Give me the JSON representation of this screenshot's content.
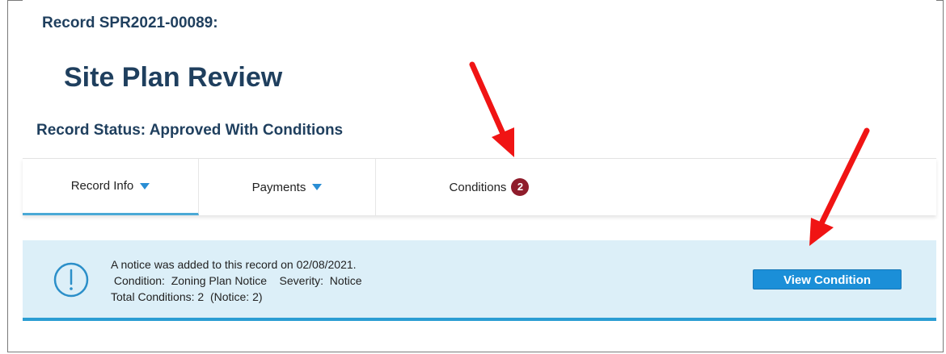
{
  "record": {
    "id_label": "Record SPR2021-00089:",
    "type_title": "Site Plan Review",
    "status_label": "Record Status: Approved With Conditions"
  },
  "tabs": [
    {
      "label": "Record Info",
      "has_dropdown": true,
      "active": true
    },
    {
      "label": "Payments",
      "has_dropdown": true,
      "active": false
    },
    {
      "label": "Conditions",
      "badge": "2",
      "active": false
    }
  ],
  "notice": {
    "icon": "exclamation-circle-icon",
    "line1": "A notice was added to this record on 02/08/2021.",
    "line2": " Condition:  Zoning Plan Notice    Severity:  Notice",
    "line3": "Total Conditions: 2  (Notice: 2)",
    "button_label": "View Condition"
  },
  "annotations": {
    "arrow_icon": "red-arrow-icon",
    "arrow_color": "#f01414"
  },
  "colors": {
    "heading": "#1f3f5e",
    "accent": "#2b9dd3",
    "badge": "#8f1c2b",
    "notice_bg": "#dceff8",
    "button": "#1b8fd8"
  }
}
